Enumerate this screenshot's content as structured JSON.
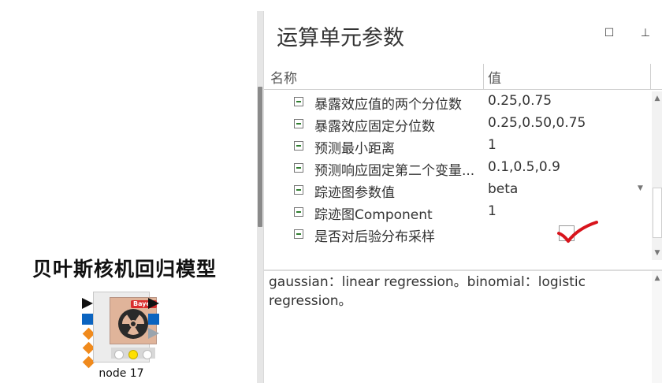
{
  "canvas": {
    "model_title": "贝叶斯核机回归模型",
    "node": {
      "badge": "Bayes",
      "label": "node 17"
    }
  },
  "panel": {
    "title": "运算单元参数",
    "maximize_icon": "maximize-icon",
    "pin_icon": "pin-icon",
    "columns": {
      "name": "名称",
      "value": "值"
    },
    "rows": [
      {
        "name": "暴露效应值的两个分位数",
        "value": "0.25,0.75"
      },
      {
        "name": "暴露效应固定分位数",
        "value": "0.25,0.50,0.75"
      },
      {
        "name": "预测最小距离",
        "value": "1"
      },
      {
        "name": "预测响应固定第二个变量...",
        "value": "0.1,0.5,0.9"
      },
      {
        "name": "踪迹图参数值",
        "value": "beta"
      },
      {
        "name": "踪迹图Component",
        "value": "1"
      },
      {
        "name": "是否对后验分布采样",
        "value": ""
      }
    ],
    "sample_posterior_checked": true,
    "description": "gaussian：linear regression。binomial：logistic regression。"
  },
  "colors": {
    "check_mark": "#d8141c",
    "port_blue": "#0b64c0",
    "port_orange": "#f08a1c"
  }
}
